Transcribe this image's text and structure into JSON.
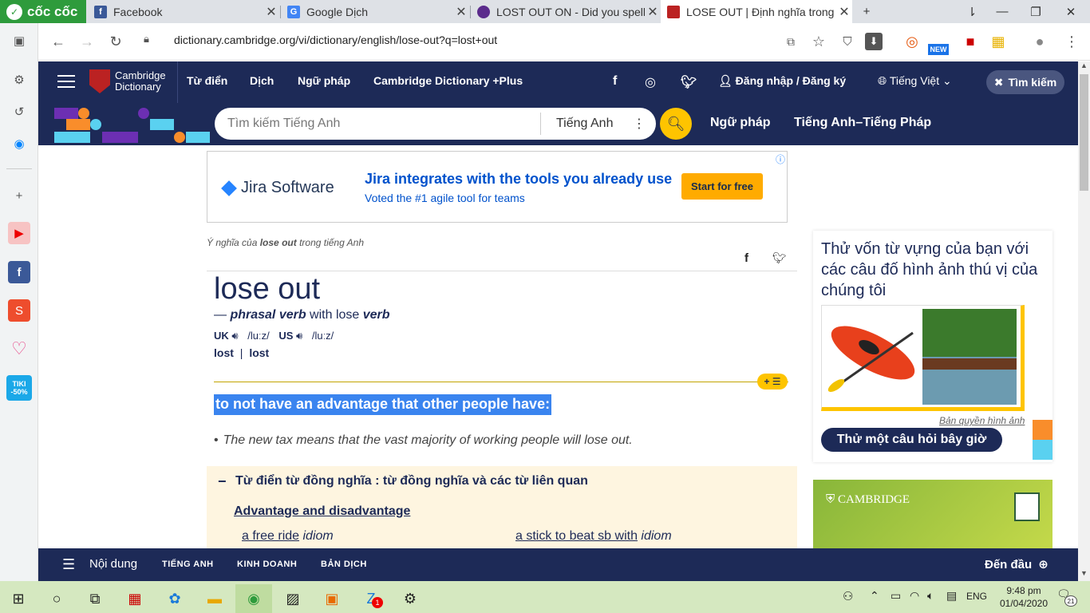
{
  "browser": {
    "brand": "cốc cốc",
    "tabs": [
      {
        "title": "Facebook",
        "icon": "facebook-icon"
      },
      {
        "title": "Google Dịch",
        "icon": "google-icon"
      },
      {
        "title": "LOST OUT ON - Did you spell",
        "icon": "globe-icon"
      },
      {
        "title": "LOSE OUT | Định nghĩa trong",
        "icon": "cambridge-icon"
      }
    ],
    "new_tab": "+",
    "url": "dictionary.cambridge.org/vi/dictionary/english/lose-out?q=lost+out",
    "new_badge": "NEW"
  },
  "site": {
    "logo_line1": "Cambridge",
    "logo_line2": "Dictionary",
    "nav": [
      "Từ điển",
      "Dịch",
      "Ngữ pháp",
      "Cambridge Dictionary +Plus"
    ],
    "login": "Đăng nhập / Đăng ký",
    "language": "Tiếng Việt",
    "search_toggle": "Tìm kiếm",
    "search_placeholder": "Tìm kiếm Tiếng Anh",
    "search_lang": "Tiếng Anh",
    "subnav": [
      "Ngữ pháp",
      "Tiếng Anh–Tiếng Pháp"
    ]
  },
  "ad": {
    "brand": "Jira Software",
    "headline": "Jira integrates with the tools you already use",
    "sub": "Voted the #1 agile tool for teams",
    "cta": "Start for free"
  },
  "entry": {
    "crumb_pre": "Ý nghĩa của ",
    "crumb_word": "lose out",
    "crumb_post": " trong tiếng Anh",
    "headword": "lose out",
    "dash": "— ",
    "pos1": "phrasal verb",
    "with": " with lose ",
    "pos2": "verb",
    "uk": "UK",
    "uk_ipa": "/luːz/",
    "us": "US",
    "us_ipa": "/luːz/",
    "form1": "lost",
    "form_sep": "|",
    "form2": "lost",
    "plus_badge": "+ ☰",
    "definition": "to not have an advantage that other people have:",
    "example": "The new tax means that the vast majority of working people will lose out.",
    "bullet": "•",
    "syn_header": "Từ điển từ đồng nghĩa : từ đồng nghĩa và các từ liên quan",
    "syn_topic": "Advantage and disadvantage",
    "syn_items": [
      {
        "term": "a free ride",
        "label": "idiom"
      },
      {
        "term": "a stick to beat sb with",
        "label": "idiom"
      }
    ]
  },
  "quiz": {
    "title": "Thử vốn từ vựng của bạn với các câu đố hình ảnh thú vị của chúng tôi",
    "credit": "Bản quyền hình ảnh",
    "button": "Thử một câu hỏi bây giờ"
  },
  "cam_ad": {
    "brand": "CAMBRIDGE"
  },
  "bottombar": {
    "menu": "Nội dung",
    "items": [
      "TIẾNG ANH",
      "KINH DOANH",
      "BẢN DỊCH"
    ],
    "top": "Đến đầu"
  },
  "taskbar": {
    "time": "9:48 pm",
    "date": "01/04/2020",
    "lang": "ENG",
    "notif": "21",
    "badge": "1"
  },
  "sidebar_badge": {
    "tiki": "TIKI",
    "discount": "-50%"
  },
  "colors": {
    "navy": "#1d2a57",
    "yellow": "#fec400",
    "highlight": "#3a84ef",
    "coccoc_green": "#2e9b3c"
  }
}
